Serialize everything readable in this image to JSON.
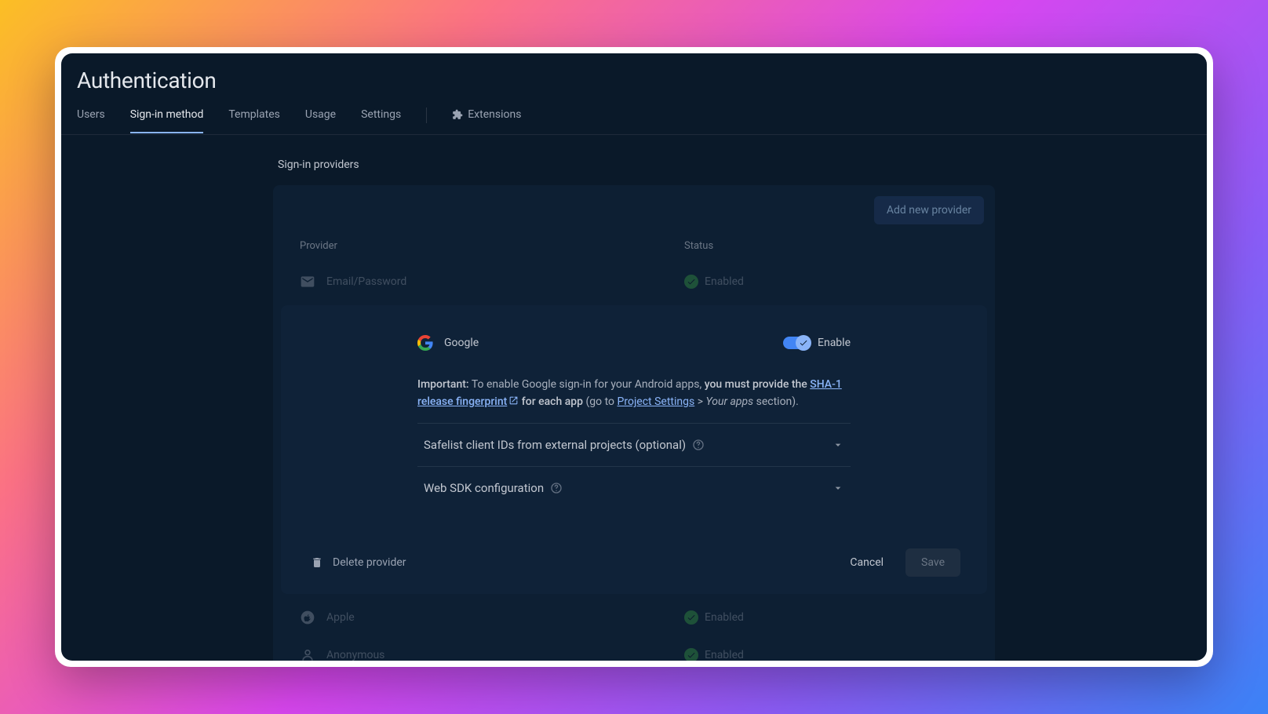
{
  "header": {
    "title": "Authentication"
  },
  "tabs": {
    "users": "Users",
    "signin": "Sign-in method",
    "templates": "Templates",
    "usage": "Usage",
    "settings": "Settings",
    "extensions": "Extensions"
  },
  "section": {
    "title": "Sign-in providers"
  },
  "buttons": {
    "add_provider": "Add new provider",
    "delete": "Delete provider",
    "cancel": "Cancel",
    "save": "Save"
  },
  "table": {
    "col_provider": "Provider",
    "col_status": "Status"
  },
  "providers": {
    "email": {
      "label": "Email/Password",
      "status": "Enabled"
    },
    "google": {
      "label": "Google"
    },
    "apple": {
      "label": "Apple",
      "status": "Enabled"
    },
    "anonymous": {
      "label": "Anonymous",
      "status": "Enabled"
    }
  },
  "panel": {
    "enable_label": "Enable",
    "important_label": "Important:",
    "info_part1": " To enable Google sign-in for your Android apps, ",
    "info_bold1": "you must provide the ",
    "sha1_link": "SHA-1 release fingerprint",
    "info_bold2": " for each app",
    "info_part2": " (go to ",
    "project_settings_link": "Project Settings",
    "info_part3": " > ",
    "your_apps": "Your apps",
    "info_part4": " section).",
    "collapsible1": "Safelist client IDs from external projects (optional)",
    "collapsible2": "Web SDK configuration"
  }
}
